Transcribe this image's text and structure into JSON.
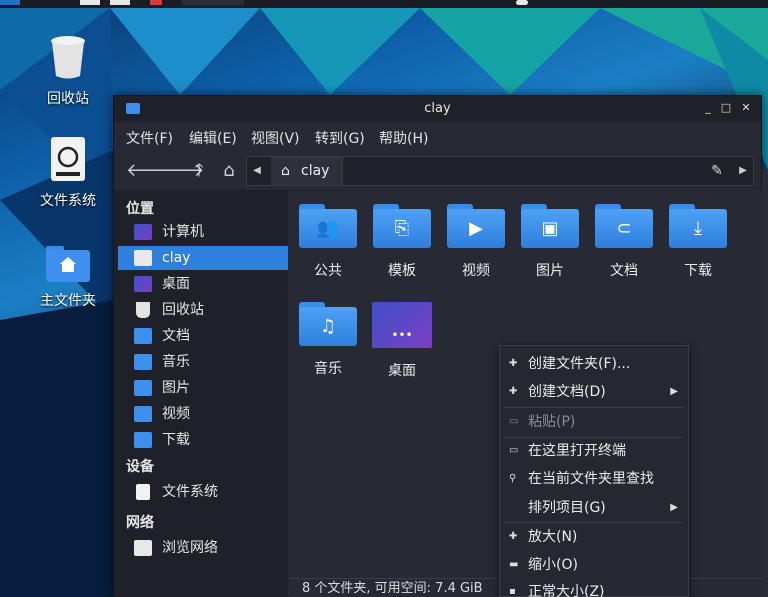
{
  "desktop": {
    "icons": [
      {
        "label": "回收站",
        "icon": "trash-icon"
      },
      {
        "label": "文件系统",
        "icon": "drive-icon"
      },
      {
        "label": "主文件夹",
        "icon": "home-folder-icon"
      }
    ]
  },
  "window": {
    "title": "clay",
    "menu": [
      "文件(F)",
      "编辑(E)",
      "视图(V)",
      "转到(G)",
      "帮助(H)"
    ],
    "path": {
      "crumb": "clay"
    },
    "sidebar": {
      "sections": [
        {
          "title": "位置",
          "items": [
            "计算机",
            "clay",
            "桌面",
            "回收站",
            "文档",
            "音乐",
            "图片",
            "视频",
            "下载"
          ]
        },
        {
          "title": "设备",
          "items": [
            "文件系统"
          ]
        },
        {
          "title": "网络",
          "items": [
            "浏览网络"
          ]
        }
      ],
      "selected": "clay"
    },
    "files": [
      {
        "label": "公共",
        "icon": "people-icon"
      },
      {
        "label": "模板",
        "icon": "template-icon"
      },
      {
        "label": "视频",
        "icon": "video-icon"
      },
      {
        "label": "图片",
        "icon": "picture-icon"
      },
      {
        "label": "文档",
        "icon": "attachment-icon"
      },
      {
        "label": "下载",
        "icon": "download-icon"
      },
      {
        "label": "音乐",
        "icon": "music-icon"
      },
      {
        "label": "桌面",
        "icon": "desktop-icon"
      }
    ],
    "status": "8 个文件夹, 可用空间: 7.4 GiB"
  },
  "context_menu": {
    "items": [
      {
        "label": "创建文件夹(F)...",
        "icon": "plus-icon",
        "submenu": false,
        "disabled": false
      },
      {
        "label": "创建文档(D)",
        "icon": "plus-icon",
        "submenu": true,
        "disabled": false
      },
      {
        "label": "粘贴(P)",
        "icon": "paste-icon",
        "submenu": false,
        "disabled": true
      },
      {
        "label": "在这里打开终端",
        "icon": "terminal-icon",
        "submenu": false,
        "disabled": false
      },
      {
        "label": "在当前文件夹里查找",
        "icon": "search-icon",
        "submenu": false,
        "disabled": false
      },
      {
        "label": "排列项目(G)",
        "icon": "",
        "submenu": true,
        "disabled": false
      },
      {
        "label": "放大(N)",
        "icon": "zoom-in-icon",
        "submenu": false,
        "disabled": false
      },
      {
        "label": "缩小(O)",
        "icon": "zoom-out-icon",
        "submenu": false,
        "disabled": false
      },
      {
        "label": "正常大小(Z)",
        "icon": "zoom-normal-icon",
        "submenu": false,
        "disabled": false
      }
    ]
  },
  "colors": {
    "accent": "#2f7fdc",
    "folder": "#3f8fee",
    "window_bg": "#272a34",
    "sidebar_bg": "#1f2129"
  }
}
